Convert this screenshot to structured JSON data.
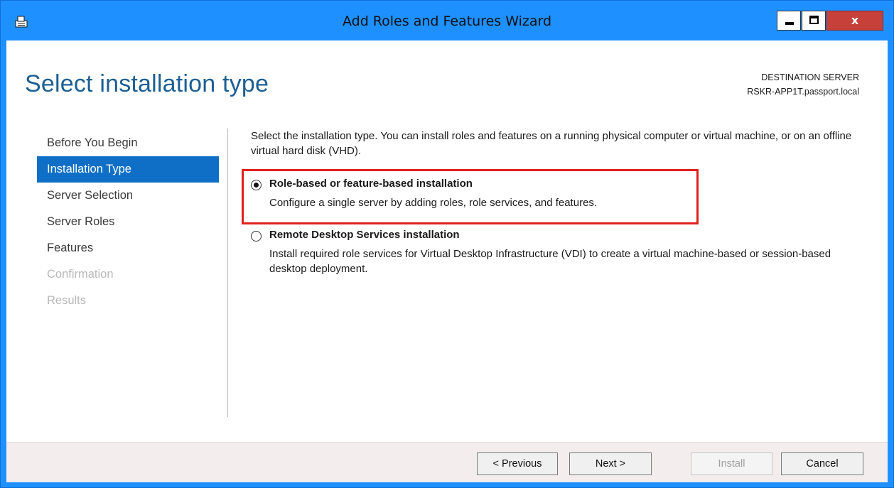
{
  "window": {
    "title": "Add Roles and Features Wizard",
    "close_glyph": "x"
  },
  "page": {
    "title": "Select installation type",
    "destination_label": "DESTINATION SERVER",
    "destination_server": "RSKR-APP1T.passport.local"
  },
  "nav": {
    "items": [
      {
        "label": "Before You Begin",
        "state": "normal"
      },
      {
        "label": "Installation Type",
        "state": "active"
      },
      {
        "label": "Server Selection",
        "state": "normal"
      },
      {
        "label": "Server Roles",
        "state": "normal"
      },
      {
        "label": "Features",
        "state": "normal"
      },
      {
        "label": "Confirmation",
        "state": "disabled"
      },
      {
        "label": "Results",
        "state": "disabled"
      }
    ]
  },
  "content": {
    "intro": "Select the installation type. You can install roles and features on a running physical computer or virtual machine, or on an offline virtual hard disk (VHD).",
    "options": [
      {
        "label": "Role-based or feature-based installation",
        "description": "Configure a single server by adding roles, role services, and features.",
        "selected": true
      },
      {
        "label": "Remote Desktop Services installation",
        "description": "Install required role services for Virtual Desktop Infrastructure (VDI) to create a virtual machine-based or session-based desktop deployment.",
        "selected": false
      }
    ]
  },
  "footer": {
    "previous_label": "< Previous",
    "next_label": "Next >",
    "install_label": "Install",
    "cancel_label": "Cancel"
  },
  "colors": {
    "titlebar": "#1e90ff",
    "accent": "#0f6fc6",
    "highlight_border": "#e0201c",
    "close_button": "#c7403a"
  }
}
